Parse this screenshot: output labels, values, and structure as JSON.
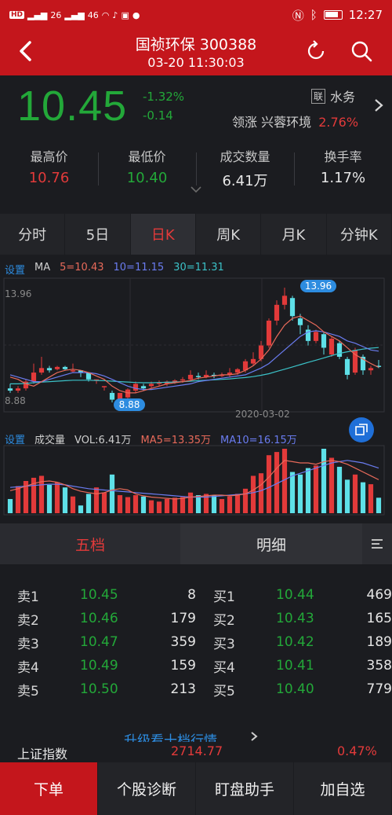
{
  "status_bar": {
    "network_label": "HD",
    "signal1": "26",
    "signal2": "46",
    "time": "12:27"
  },
  "header": {
    "title": "国祯环保 300388",
    "datetime": "03-20 11:30:03"
  },
  "quote": {
    "price": "10.45",
    "change_pct": "-1.32%",
    "change_abs": "-0.14",
    "badge": "联",
    "concept": "水务",
    "leader_label": "领涨",
    "leader_name": "兴蓉环境",
    "leader_pct": "2.76%"
  },
  "stats": [
    {
      "label": "最高价",
      "value": "10.76",
      "color": "#e23a3a"
    },
    {
      "label": "最低价",
      "value": "10.40",
      "color": "#23a839"
    },
    {
      "label": "成交数量",
      "value": "6.41万",
      "color": "#e6e6e6"
    },
    {
      "label": "换手率",
      "value": "1.17%",
      "color": "#e6e6e6"
    }
  ],
  "period_tabs": [
    "分时",
    "5日",
    "日K",
    "周K",
    "月K",
    "分钟K"
  ],
  "active_period": "日K",
  "ma_legend": {
    "settings": "设置",
    "ma": "MA",
    "ma5": "5=10.43",
    "ma10": "10=11.15",
    "ma30": "30=11.31"
  },
  "kline": {
    "y_top": "13.96",
    "y_bottom": "8.88",
    "max_label": "13.96",
    "min_label": "8.88",
    "date_label": "2020-03-02"
  },
  "vol_legend": {
    "settings": "设置",
    "label": "成交量",
    "vol": "VOL:6.41万",
    "ma5": "MA5=13.35万",
    "ma10": "MA10=16.15万"
  },
  "chart_data": {
    "type": "candlestick",
    "ylim": [
      8.88,
      13.96
    ],
    "candles": [
      {
        "o": 9.5,
        "c": 9.4,
        "h": 9.7,
        "l": 9.3
      },
      {
        "o": 9.4,
        "c": 9.5,
        "h": 9.6,
        "l": 9.3
      },
      {
        "o": 9.5,
        "c": 9.8,
        "h": 9.9,
        "l": 9.4
      },
      {
        "o": 9.8,
        "c": 10.2,
        "h": 10.6,
        "l": 9.7
      },
      {
        "o": 10.2,
        "c": 10.4,
        "h": 10.9,
        "l": 10.1
      },
      {
        "o": 10.4,
        "c": 10.3,
        "h": 10.5,
        "l": 10.2
      },
      {
        "o": 10.35,
        "c": 10.45,
        "h": 10.5,
        "l": 10.3
      },
      {
        "o": 10.45,
        "c": 10.35,
        "h": 10.5,
        "l": 10.3
      },
      {
        "o": 10.3,
        "c": 10.3,
        "h": 10.6,
        "l": 10.2
      },
      {
        "o": 10.3,
        "c": 10.2,
        "h": 10.3,
        "l": 10.0
      },
      {
        "o": 10.2,
        "c": 9.9,
        "h": 10.2,
        "l": 9.8
      },
      {
        "o": 9.9,
        "c": 9.9,
        "h": 9.9,
        "l": 9.7
      },
      {
        "o": 9.6,
        "c": 9.6,
        "h": 9.6,
        "l": 9.4
      },
      {
        "o": 9.3,
        "c": 9.0,
        "h": 9.4,
        "l": 8.88
      },
      {
        "o": 9.0,
        "c": 9.3,
        "h": 9.3,
        "l": 8.9
      },
      {
        "o": 9.1,
        "c": 9.45,
        "h": 9.5,
        "l": 9.0
      },
      {
        "o": 9.4,
        "c": 9.7,
        "h": 9.8,
        "l": 9.3
      },
      {
        "o": 9.6,
        "c": 9.5,
        "h": 9.7,
        "l": 9.4
      },
      {
        "o": 9.6,
        "c": 9.7,
        "h": 9.8,
        "l": 9.5
      },
      {
        "o": 9.7,
        "c": 9.75,
        "h": 9.85,
        "l": 9.6
      },
      {
        "o": 9.7,
        "c": 9.8,
        "h": 9.85,
        "l": 9.6
      },
      {
        "o": 9.8,
        "c": 9.85,
        "h": 9.9,
        "l": 9.7
      },
      {
        "o": 9.85,
        "c": 9.9,
        "h": 10.0,
        "l": 9.75
      },
      {
        "o": 9.9,
        "c": 10.1,
        "h": 10.3,
        "l": 9.85
      },
      {
        "o": 10.05,
        "c": 10.0,
        "h": 10.2,
        "l": 9.9
      },
      {
        "o": 10.0,
        "c": 10.1,
        "h": 10.3,
        "l": 9.95
      },
      {
        "o": 10.1,
        "c": 10.05,
        "h": 10.2,
        "l": 9.95
      },
      {
        "o": 10.05,
        "c": 10.1,
        "h": 10.2,
        "l": 10.0
      },
      {
        "o": 10.1,
        "c": 10.2,
        "h": 10.4,
        "l": 10.0
      },
      {
        "o": 10.2,
        "c": 10.35,
        "h": 10.4,
        "l": 10.1
      },
      {
        "o": 10.3,
        "c": 10.7,
        "h": 10.8,
        "l": 10.2
      },
      {
        "o": 10.6,
        "c": 10.8,
        "h": 11.1,
        "l": 10.5
      },
      {
        "o": 10.8,
        "c": 11.4,
        "h": 11.6,
        "l": 10.7
      },
      {
        "o": 11.4,
        "c": 12.5,
        "h": 12.6,
        "l": 11.3
      },
      {
        "o": 12.5,
        "c": 13.2,
        "h": 13.4,
        "l": 12.3
      },
      {
        "o": 13.2,
        "c": 13.6,
        "h": 13.96,
        "l": 13.0
      },
      {
        "o": 13.5,
        "c": 12.7,
        "h": 13.6,
        "l": 12.5
      },
      {
        "o": 12.6,
        "c": 12.3,
        "h": 12.8,
        "l": 11.9
      },
      {
        "o": 12.1,
        "c": 11.6,
        "h": 12.3,
        "l": 11.4
      },
      {
        "o": 11.6,
        "c": 12.0,
        "h": 12.1,
        "l": 11.5
      },
      {
        "o": 11.9,
        "c": 11.3,
        "h": 12.0,
        "l": 11.0
      },
      {
        "o": 11.0,
        "c": 11.7,
        "h": 11.8,
        "l": 10.9
      },
      {
        "o": 11.5,
        "c": 10.9,
        "h": 11.6,
        "l": 10.8
      },
      {
        "o": 10.8,
        "c": 10.1,
        "h": 10.9,
        "l": 9.9
      },
      {
        "o": 10.2,
        "c": 11.2,
        "h": 11.3,
        "l": 10.1
      },
      {
        "o": 10.9,
        "c": 10.3,
        "h": 11.0,
        "l": 10.1
      },
      {
        "o": 10.3,
        "c": 10.4,
        "h": 10.5,
        "l": 10.1
      },
      {
        "o": 10.5,
        "c": 10.45,
        "h": 10.76,
        "l": 10.4
      }
    ],
    "volume": [
      22,
      42,
      50,
      55,
      58,
      44,
      48,
      40,
      26,
      12,
      30,
      40,
      32,
      60,
      28,
      25,
      28,
      26,
      20,
      18,
      22,
      24,
      25,
      32,
      28,
      30,
      28,
      22,
      26,
      30,
      38,
      58,
      62,
      90,
      95,
      100,
      64,
      60,
      70,
      74,
      100,
      86,
      72,
      52,
      60,
      48,
      45,
      24
    ],
    "ma5": [
      10.0,
      9.9,
      9.7,
      9.6,
      9.8,
      10.0,
      10.2,
      10.3,
      10.35,
      10.3,
      10.2,
      10.05,
      9.9,
      9.6,
      9.4,
      9.3,
      9.3,
      9.4,
      9.5,
      9.6,
      9.7,
      9.75,
      9.8,
      9.85,
      9.95,
      10.0,
      10.05,
      10.1,
      10.1,
      10.15,
      10.3,
      10.5,
      10.8,
      11.2,
      11.8,
      12.3,
      12.6,
      12.7,
      12.5,
      12.3,
      12.0,
      11.8,
      11.6,
      11.3,
      11.0,
      10.8,
      10.6,
      10.43
    ],
    "ma10": [
      10.1,
      10.0,
      9.9,
      9.8,
      9.8,
      9.9,
      10.0,
      10.1,
      10.2,
      10.2,
      10.2,
      10.15,
      10.05,
      9.9,
      9.75,
      9.6,
      9.5,
      9.45,
      9.45,
      9.5,
      9.55,
      9.6,
      9.65,
      9.7,
      9.8,
      9.85,
      9.9,
      9.95,
      10.0,
      10.05,
      10.1,
      10.25,
      10.4,
      10.6,
      10.9,
      11.2,
      11.5,
      11.8,
      12.0,
      12.05,
      12.0,
      11.9,
      11.8,
      11.6,
      11.5,
      11.35,
      11.2,
      11.15
    ],
    "ma30": [
      9.7,
      9.7,
      9.72,
      9.75,
      9.78,
      9.8,
      9.82,
      9.84,
      9.86,
      9.86,
      9.86,
      9.85,
      9.84,
      9.82,
      9.8,
      9.78,
      9.76,
      9.75,
      9.75,
      9.76,
      9.77,
      9.78,
      9.8,
      9.82,
      9.84,
      9.86,
      9.88,
      9.9,
      9.92,
      9.95,
      9.98,
      10.02,
      10.08,
      10.15,
      10.25,
      10.35,
      10.45,
      10.55,
      10.65,
      10.75,
      10.85,
      10.95,
      11.05,
      11.12,
      11.18,
      11.24,
      11.28,
      11.31
    ],
    "vol_ma5": [
      35,
      38,
      42,
      46,
      49,
      50,
      48,
      44,
      38,
      34,
      32,
      30,
      32,
      36,
      38,
      36,
      30,
      27,
      25,
      24,
      23,
      22,
      23,
      25,
      26,
      27,
      28,
      28,
      27,
      28,
      30,
      36,
      44,
      56,
      70,
      82,
      80,
      78,
      78,
      76,
      80,
      82,
      80,
      76,
      70,
      64,
      58,
      52
    ],
    "vol_ma10": [
      40,
      41,
      42,
      43,
      44,
      45,
      45,
      44,
      42,
      40,
      38,
      37,
      36,
      35,
      34,
      33,
      32,
      31,
      30,
      29,
      28,
      27,
      26,
      25,
      25,
      25,
      26,
      27,
      28,
      29,
      30,
      32,
      35,
      40,
      46,
      52,
      58,
      62,
      66,
      70,
      74,
      78,
      80,
      82,
      80,
      78,
      74,
      70
    ]
  },
  "book_tabs": {
    "five": "五档",
    "detail": "明细"
  },
  "book": {
    "sell": [
      {
        "name": "卖1",
        "price": "10.45",
        "qty": "8"
      },
      {
        "name": "卖2",
        "price": "10.46",
        "qty": "179"
      },
      {
        "name": "卖3",
        "price": "10.47",
        "qty": "359"
      },
      {
        "name": "卖4",
        "price": "10.49",
        "qty": "159"
      },
      {
        "name": "卖5",
        "price": "10.50",
        "qty": "213"
      }
    ],
    "buy": [
      {
        "name": "买1",
        "price": "10.44",
        "qty": "469"
      },
      {
        "name": "买2",
        "price": "10.43",
        "qty": "165"
      },
      {
        "name": "买3",
        "price": "10.42",
        "qty": "189"
      },
      {
        "name": "买4",
        "price": "10.41",
        "qty": "358"
      },
      {
        "name": "买5",
        "price": "10.40",
        "qty": "779"
      }
    ]
  },
  "upgrade_text": "升级看十档行情",
  "index_bar": {
    "name": "上证指数",
    "value": "2714.77",
    "pct": "0.47%"
  },
  "bottom_bar": [
    "下单",
    "个股诊断",
    "盯盘助手",
    "加自选"
  ],
  "colors": {
    "brand_red": "#c4161c",
    "up": "#e23a3a",
    "down": "#23a839",
    "cyan": "#5ee0e8",
    "ma_blue": "#6a7cf0",
    "ma_teal": "#3bc2c8"
  }
}
